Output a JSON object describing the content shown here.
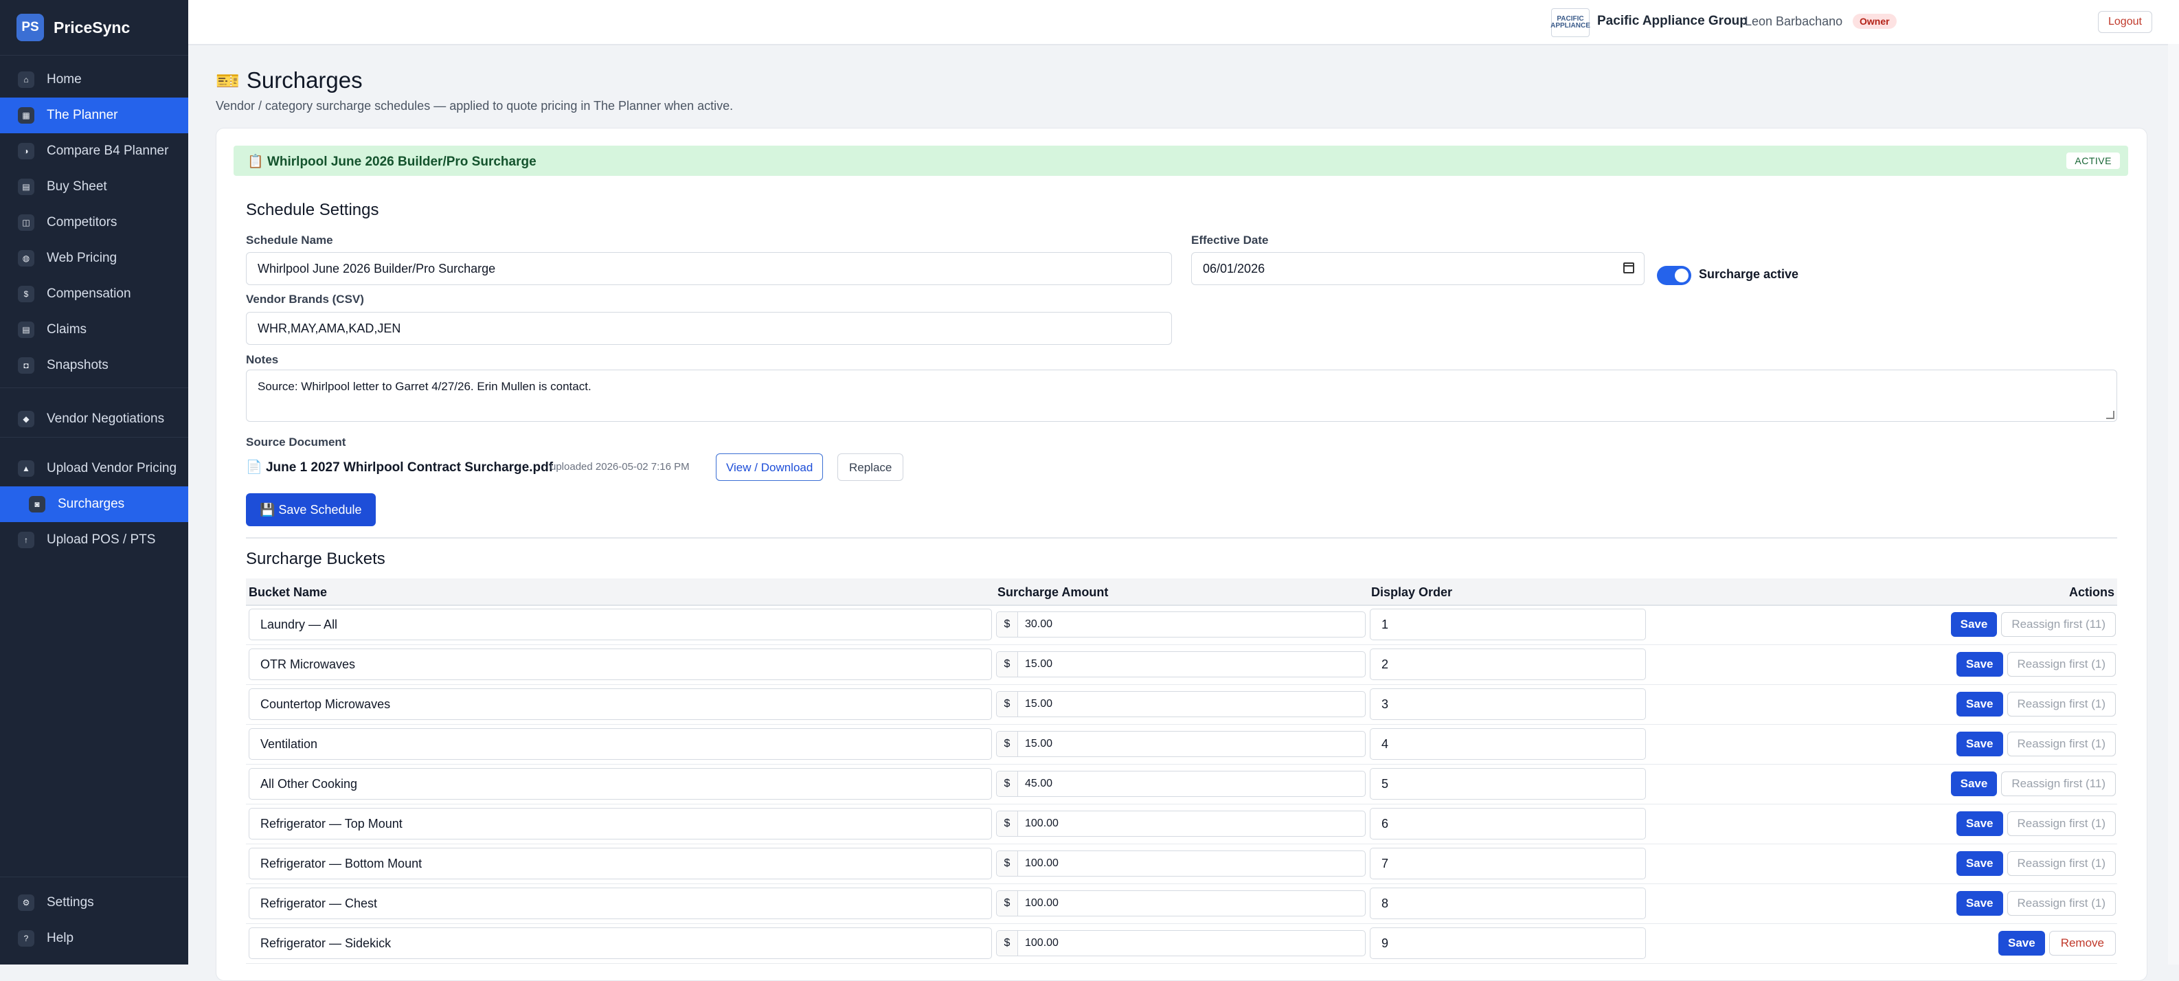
{
  "app": {
    "logo_text": "PS",
    "name": "PriceSync"
  },
  "sidebar": {
    "items": [
      {
        "label": "Home",
        "icon": "home-icon",
        "glyph": "⌂"
      },
      {
        "label": "The Planner",
        "icon": "planner-icon",
        "glyph": "▦"
      },
      {
        "label": "Compare B4 Planner",
        "icon": "compare-icon",
        "glyph": "◑"
      },
      {
        "label": "Buy Sheet",
        "icon": "clipboard-icon",
        "glyph": "▤"
      },
      {
        "label": "Competitors",
        "icon": "tag-icon",
        "glyph": "◫"
      },
      {
        "label": "Web Pricing",
        "icon": "globe-icon",
        "glyph": "◍"
      },
      {
        "label": "Compensation",
        "icon": "money-bag-icon",
        "glyph": "$"
      },
      {
        "label": "Claims",
        "icon": "document-icon",
        "glyph": "▤"
      },
      {
        "label": "Snapshots",
        "icon": "camera-icon",
        "glyph": "◘"
      },
      {
        "label": "Vendor Negotiations",
        "icon": "handshake-icon",
        "glyph": "◆"
      },
      {
        "label": "Upload Vendor Pricing",
        "icon": "upload-icon",
        "glyph": "▲"
      },
      {
        "label": "Surcharges",
        "icon": "ticket-icon",
        "glyph": "◙"
      },
      {
        "label": "Upload POS / PTS",
        "icon": "arrow-up-icon",
        "glyph": "↑"
      },
      {
        "label": "Settings",
        "icon": "gear-icon",
        "glyph": "⚙"
      },
      {
        "label": "Help",
        "icon": "question-icon",
        "glyph": "?"
      }
    ]
  },
  "topbar": {
    "org_logo_text": "PACIFIC APPLIANCE",
    "org_name": "Pacific Appliance Group",
    "user": "Leon Barbachano",
    "role": "Owner",
    "logout": "Logout"
  },
  "page": {
    "title": "Surcharges",
    "title_icon": "🎫",
    "subtitle": "Vendor / category surcharge schedules — applied to quote pricing in The Planner when active."
  },
  "schedule": {
    "bar_icon": "📋",
    "bar_name": "Whirlpool June 2026 Builder/Pro Surcharge",
    "status": "ACTIVE",
    "settings_title": "Schedule Settings",
    "name_label": "Schedule Name",
    "name_value": "Whirlpool June 2026 Builder/Pro Surcharge",
    "date_label": "Effective Date",
    "date_value": "06/01/2026",
    "active_label": "Surcharge active",
    "brands_label": "Vendor Brands (CSV)",
    "brands_value": "WHR,MAY,AMA,KAD,JEN",
    "notes_label": "Notes",
    "notes_value": "Source: Whirlpool letter to Garret 4/27/26. Erin Mullen is contact.",
    "source_label": "Source Document",
    "doc_icon": "📄",
    "doc_name": "June 1 2027 Whirlpool Contract Surcharge.pdf",
    "doc_uploaded": "uploaded 2026-05-02 7:16 PM",
    "view_btn": "View / Download",
    "replace_btn": "Replace",
    "save_btn": "💾 Save Schedule"
  },
  "buckets": {
    "title": "Surcharge Buckets",
    "headers": {
      "name": "Bucket Name",
      "amount": "Surcharge Amount",
      "order": "Display Order",
      "actions": "Actions"
    },
    "currency": "$",
    "save_label": "Save",
    "rows": [
      {
        "name": "Laundry — All",
        "amount": "30.00",
        "order": "1",
        "secondary": "Reassign first (11)",
        "kind": "reassign"
      },
      {
        "name": "OTR Microwaves",
        "amount": "15.00",
        "order": "2",
        "secondary": "Reassign first (1)",
        "kind": "reassign"
      },
      {
        "name": "Countertop Microwaves",
        "amount": "15.00",
        "order": "3",
        "secondary": "Reassign first (1)",
        "kind": "reassign"
      },
      {
        "name": "Ventilation",
        "amount": "15.00",
        "order": "4",
        "secondary": "Reassign first (1)",
        "kind": "reassign"
      },
      {
        "name": "All Other Cooking",
        "amount": "45.00",
        "order": "5",
        "secondary": "Reassign first (11)",
        "kind": "reassign"
      },
      {
        "name": "Refrigerator — Top Mount",
        "amount": "100.00",
        "order": "6",
        "secondary": "Reassign first (1)",
        "kind": "reassign"
      },
      {
        "name": "Refrigerator — Bottom Mount",
        "amount": "100.00",
        "order": "7",
        "secondary": "Reassign first (1)",
        "kind": "reassign"
      },
      {
        "name": "Refrigerator — Chest",
        "amount": "100.00",
        "order": "8",
        "secondary": "Reassign first (1)",
        "kind": "reassign"
      },
      {
        "name": "Refrigerator — Sidekick",
        "amount": "100.00",
        "order": "9",
        "secondary": "Remove",
        "kind": "remove"
      }
    ]
  },
  "colors": {
    "sidebar_bg": "#1c2536",
    "accent": "#2563eb",
    "active_bar": "#d6f5dd",
    "danger": "#c0392b"
  }
}
